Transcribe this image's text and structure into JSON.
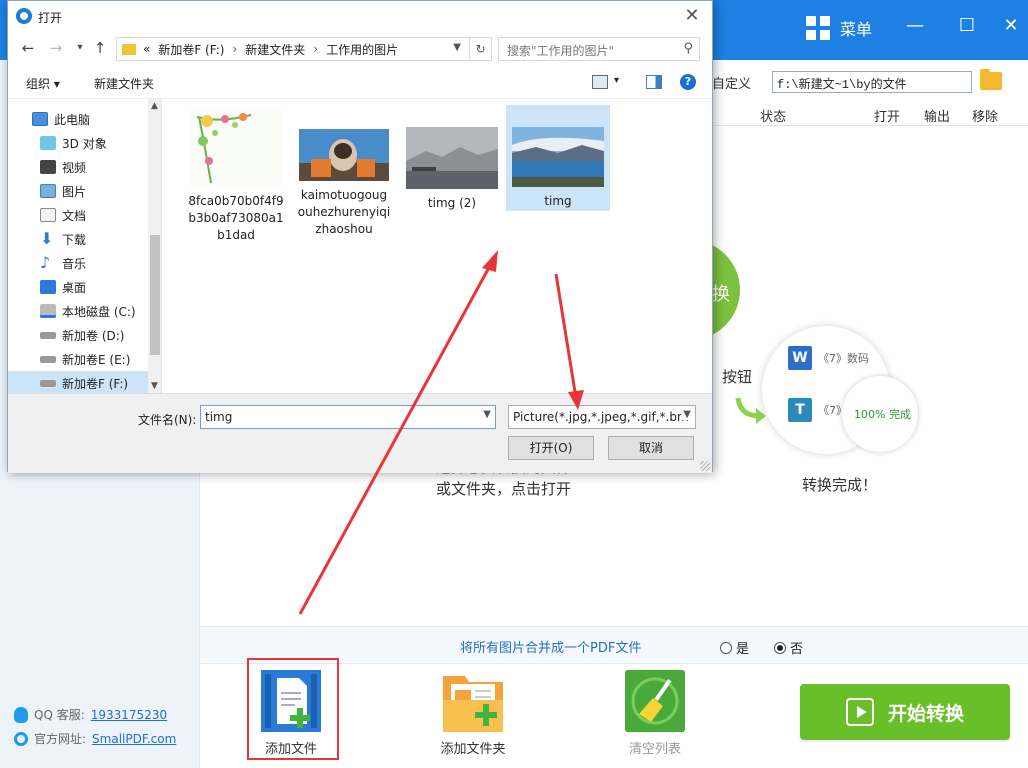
{
  "app": {
    "menu_label": "菜单",
    "custom_label": "自定义",
    "output_path": "f:\\新建文~1\\by的文件",
    "columns": {
      "status": "状态",
      "open": "打开",
      "output": "输出",
      "remove": "移除"
    },
    "hint_convert": "换",
    "hint_button": "按钮",
    "hint_left_line1": "选择想要转换的文件",
    "hint_left_line2": "或文件夹，点击打开",
    "result_row1": "《7》数码",
    "result_row2": "《7》",
    "progress": "100%  完成",
    "done_text": "转换完成！",
    "merge_text": "将所有图片合并成一个PDF文件",
    "merge_yes": "是",
    "merge_no": "否",
    "merge_selected": "否",
    "tools": {
      "add_file": "添加文件",
      "add_folder": "添加文件夹",
      "clear_list": "清空列表"
    },
    "start_button": "开始转换",
    "contact": {
      "qq_label": "QQ 客服:",
      "qq_value": "1933175230",
      "site_label": "官方网址:",
      "site_value": "SmallPDF.com"
    }
  },
  "dialog": {
    "title": "打开",
    "breadcrumb": [
      "«",
      "新加卷F (F:)",
      "新建文件夹",
      "工作用的图片"
    ],
    "search_placeholder": "搜索\"工作用的图片\"",
    "organize": "组织 ▾",
    "new_folder": "新建文件夹",
    "nav_items": [
      {
        "label": "此电脑",
        "icon": "pc-icon"
      },
      {
        "label": "3D 对象",
        "icon": "3d-objects-icon"
      },
      {
        "label": "视频",
        "icon": "video-icon"
      },
      {
        "label": "图片",
        "icon": "pictures-icon"
      },
      {
        "label": "文档",
        "icon": "documents-icon"
      },
      {
        "label": "下载",
        "icon": "download-icon"
      },
      {
        "label": "音乐",
        "icon": "music-icon"
      },
      {
        "label": "桌面",
        "icon": "desktop-icon"
      },
      {
        "label": "本地磁盘 (C:)",
        "icon": "drive-c-icon"
      },
      {
        "label": "新加卷 (D:)",
        "icon": "drive-icon"
      },
      {
        "label": "新加卷E (E:)",
        "icon": "drive-icon"
      },
      {
        "label": "新加卷F (F:)",
        "icon": "drive-icon"
      }
    ],
    "files": [
      {
        "name": "8fca0b70b0f4f9\nb3b0af73080a1\nb1dad",
        "selected": false
      },
      {
        "name": "kaimotuogoug\nouhezhurenyiqi\nzhaoshou",
        "selected": false
      },
      {
        "name": "timg (2)",
        "selected": false
      },
      {
        "name": "timg",
        "selected": true
      }
    ],
    "filename_label": "文件名(N):",
    "filename_value": "timg",
    "filter_value": "Picture(*.jpg,*.jpeg,*.gif,*.bm",
    "open_button": "打开(O)",
    "cancel_button": "取消"
  }
}
